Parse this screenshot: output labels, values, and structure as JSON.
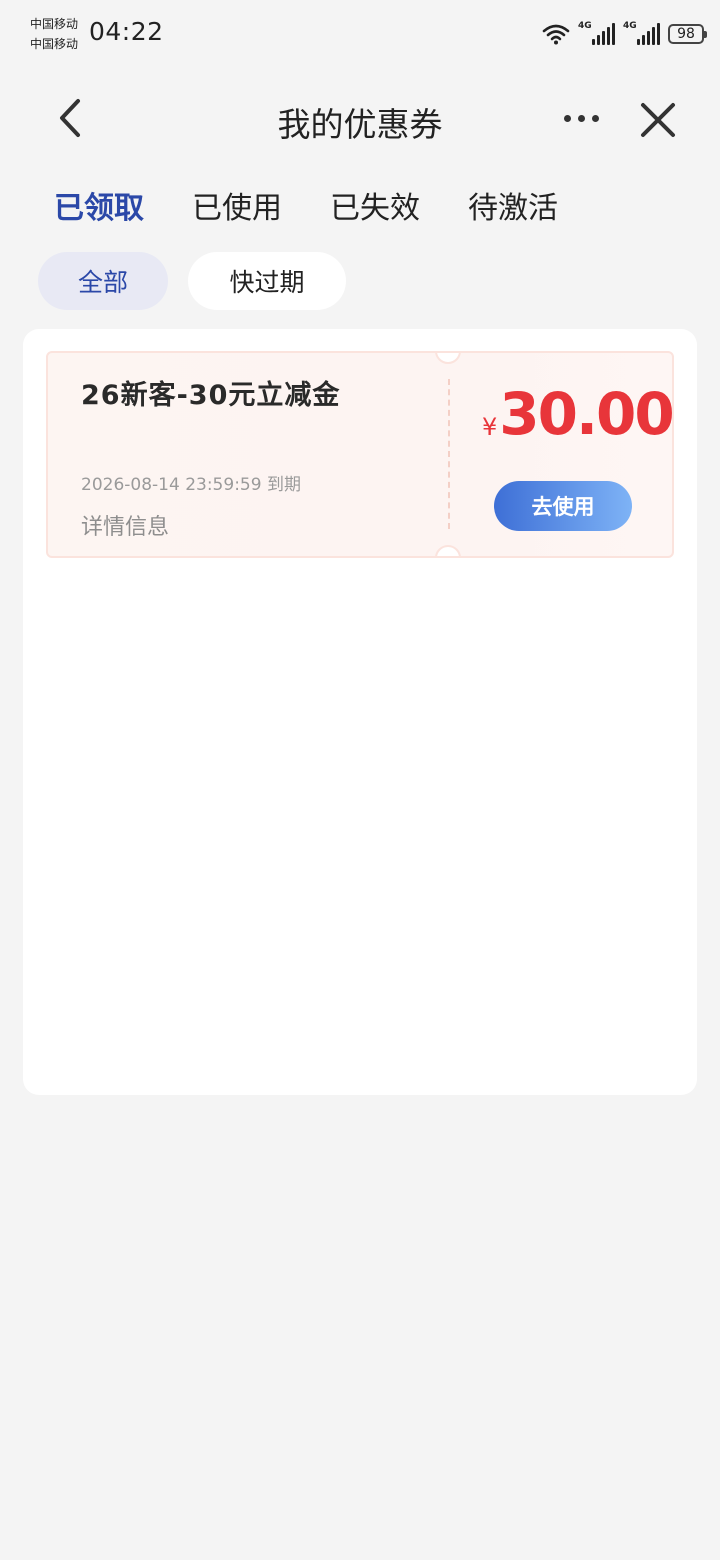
{
  "status_bar": {
    "carrier_1": "中国移动",
    "carrier_2": "中国移动",
    "time": "04:22",
    "signal_1_label": "4G",
    "signal_2_label": "4G",
    "battery": "98"
  },
  "header": {
    "title": "我的优惠券"
  },
  "tabs": [
    {
      "label": "已领取",
      "active": true
    },
    {
      "label": "已使用",
      "active": false
    },
    {
      "label": "已失效",
      "active": false
    },
    {
      "label": "待激活",
      "active": false
    }
  ],
  "filters": [
    {
      "label": "全部",
      "active": true
    },
    {
      "label": "快过期",
      "active": false
    }
  ],
  "coupons": [
    {
      "title": "26新客-30元立减金",
      "expiry": "2026-08-14 23:59:59 到期",
      "detail_label": "详情信息",
      "currency": "¥",
      "amount": "30.00",
      "use_label": "去使用"
    }
  ],
  "colors": {
    "accent": "#2b48a8",
    "amount": "#e8353a",
    "button_start": "#3e6fd6",
    "button_end": "#7eb3f6"
  }
}
